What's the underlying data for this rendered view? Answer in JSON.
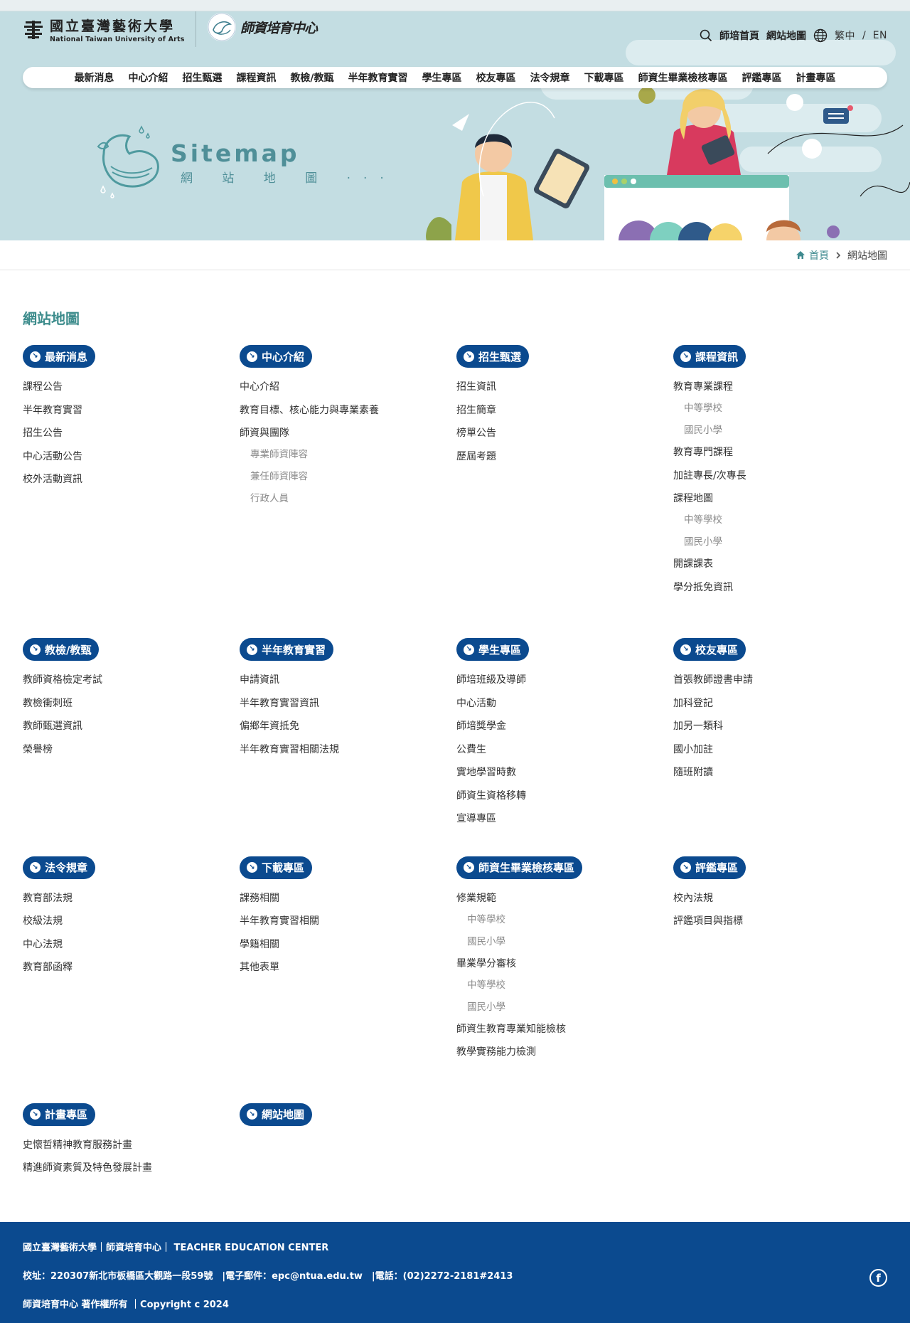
{
  "header": {
    "univ_name_zh": "國立臺灣藝術大學",
    "univ_name_en": "National Taiwan University of Arts",
    "center_name": "師資培育中心",
    "util": {
      "home_link": "師培首頁",
      "sitemap_link": "網站地圖",
      "lang_zh": "繁中",
      "lang_sep": "/",
      "lang_en": "EN"
    }
  },
  "nav": [
    "最新消息",
    "中心介紹",
    "招生甄選",
    "課程資訊",
    "教檢/教甄",
    "半年教育實習",
    "學生專區",
    "校友專區",
    "法令規章",
    "下載專區",
    "師資生畢業檢核專區",
    "評鑑專區",
    "計畫專區"
  ],
  "banner": {
    "title": "Sitemap",
    "subtitle": "網 站 地 圖 ···"
  },
  "breadcrumb": {
    "home": "首頁",
    "current": "網站地圖"
  },
  "page_title": "網站地圖",
  "sections": [
    {
      "title": "最新消息",
      "items": [
        {
          "label": "課程公告"
        },
        {
          "label": "半年教育實習"
        },
        {
          "label": "招生公告"
        },
        {
          "label": "中心活動公告"
        },
        {
          "label": "校外活動資訊"
        }
      ]
    },
    {
      "title": "中心介紹",
      "items": [
        {
          "label": "中心介紹"
        },
        {
          "label": "教育目標、核心能力與專業素養"
        },
        {
          "label": "師資與團隊",
          "sub": [
            "專業師資陣容",
            "兼任師資陣容",
            "行政人員"
          ]
        }
      ]
    },
    {
      "title": "招生甄選",
      "items": [
        {
          "label": "招生資訊"
        },
        {
          "label": "招生簡章"
        },
        {
          "label": "榜單公告"
        },
        {
          "label": "歷屆考題"
        }
      ]
    },
    {
      "title": "課程資訊",
      "items": [
        {
          "label": "教育專業課程",
          "sub": [
            "中等學校",
            "國民小學"
          ]
        },
        {
          "label": "教育專門課程"
        },
        {
          "label": "加註專長/次專長"
        },
        {
          "label": "課程地圖",
          "sub": [
            "中等學校",
            "國民小學"
          ]
        },
        {
          "label": "開課課表"
        },
        {
          "label": "學分抵免資訊"
        }
      ]
    },
    {
      "title": "教檢/教甄",
      "items": [
        {
          "label": "教師資格檢定考試"
        },
        {
          "label": "教檢衝刺班"
        },
        {
          "label": "教師甄選資訊"
        },
        {
          "label": "榮譽榜"
        }
      ]
    },
    {
      "title": "半年教育實習",
      "items": [
        {
          "label": "申請資訊"
        },
        {
          "label": "半年教育實習資訊"
        },
        {
          "label": "偏鄉年資抵免"
        },
        {
          "label": "半年教育實習相關法規"
        }
      ]
    },
    {
      "title": "學生專區",
      "items": [
        {
          "label": "師培班級及導師"
        },
        {
          "label": "中心活動"
        },
        {
          "label": "師培獎學金"
        },
        {
          "label": "公費生"
        },
        {
          "label": "實地學習時數"
        },
        {
          "label": "師資生資格移轉"
        },
        {
          "label": "宣導專區"
        }
      ]
    },
    {
      "title": "校友專區",
      "items": [
        {
          "label": "首張教師證書申請"
        },
        {
          "label": "加科登記"
        },
        {
          "label": "加另一類科"
        },
        {
          "label": "國小加註"
        },
        {
          "label": "隨班附讀"
        }
      ]
    },
    {
      "title": "法令規章",
      "items": [
        {
          "label": "教育部法規"
        },
        {
          "label": "校級法規"
        },
        {
          "label": "中心法規"
        },
        {
          "label": "教育部函釋"
        }
      ]
    },
    {
      "title": "下載專區",
      "items": [
        {
          "label": "課務相關"
        },
        {
          "label": "半年教育實習相關"
        },
        {
          "label": "學籍相關"
        },
        {
          "label": "其他表單"
        }
      ]
    },
    {
      "title": "師資生畢業檢核專區",
      "items": [
        {
          "label": "修業規範",
          "sub": [
            "中等學校",
            "國民小學"
          ]
        },
        {
          "label": "畢業學分審核",
          "sub": [
            "中等學校",
            "國民小學"
          ]
        },
        {
          "label": "師資生教育專業知能檢核"
        },
        {
          "label": "教學實務能力檢測"
        }
      ]
    },
    {
      "title": "評鑑專區",
      "items": [
        {
          "label": "校內法規"
        },
        {
          "label": "評鑑項目與指標"
        }
      ]
    },
    {
      "title": "計畫專區",
      "items": [
        {
          "label": "史懷哲精神教育服務計畫"
        },
        {
          "label": "精進師資素質及特色發展計畫"
        }
      ]
    },
    {
      "title": "網站地圖",
      "items": []
    }
  ],
  "footer": {
    "line1": "國立臺灣藝術大學｜師資培育中心｜ TEACHER EDUCATION CENTER",
    "line2": "校址：220307新北市板橋區大觀路一段59號　|電子郵件：epc@ntua.edu.tw　|電話：(02)2272-2181#2413",
    "line3": "師資培育中心 著作權所有 ｜Copyright c 2024",
    "fb_glyph": "f"
  },
  "colors": {
    "primary": "#0b4a8f",
    "accent": "#3d8c8c",
    "banner_bg": "#c3dde2"
  }
}
